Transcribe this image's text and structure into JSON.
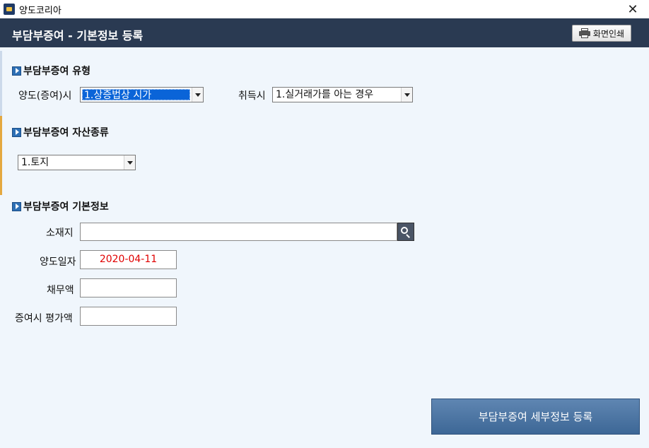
{
  "window": {
    "title": "양도코리아",
    "close_glyph": "✕",
    "app_icon": "app-logo-icon"
  },
  "header": {
    "title": "부담부증여 - 기본정보 등록",
    "print_label": "화면인쇄",
    "print_icon": "printer-icon"
  },
  "sections": {
    "type": {
      "title": "부담부증여 유형"
    },
    "asset": {
      "title": "부담부증여 자산종류"
    },
    "basic": {
      "title": "부담부증여 기본정보"
    }
  },
  "form": {
    "transfer_label": "양도(증여)시",
    "transfer_value": "1.상증법상 시가",
    "acquire_label": "취득시",
    "acquire_value": "1.실거래가를 아는 경우",
    "asset_value": "1.토지",
    "location_label": "소재지",
    "location_value": "",
    "transfer_date_label": "양도일자",
    "transfer_date_value": "2020-04-11",
    "debt_label": "채무액",
    "debt_value": "",
    "gift_value_label": "증여시 평가액",
    "gift_value_value": ""
  },
  "actions": {
    "detail_button": "부담부증여 세부정보 등록"
  },
  "colors": {
    "header_bg": "#2a3a52",
    "content_bg": "#f0f6fc",
    "date_text": "#e00000",
    "button_bg": "#4a74a4",
    "section_icon": "#2d6fb5"
  }
}
